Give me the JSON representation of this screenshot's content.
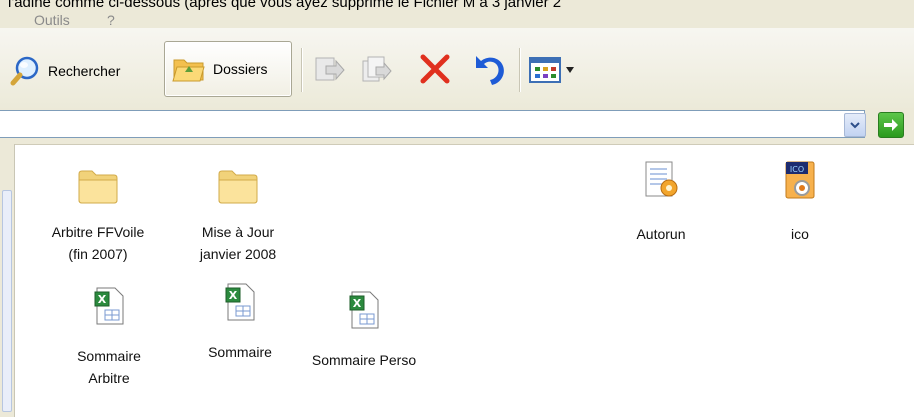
{
  "top_caption": "l'adine comme ci-dessous (après que vous ayez supprimé le Fichier M à 3 janvier 2",
  "menu": {
    "items": [
      "Outils",
      "?"
    ]
  },
  "toolbar": {
    "search_label": "Rechercher",
    "folders_label": "Dossiers",
    "icons": [
      "search-icon",
      "folders-icon",
      "move-to-icon",
      "copy-to-icon",
      "delete-icon",
      "undo-icon",
      "views-icon"
    ]
  },
  "address": {
    "value": ""
  },
  "files": [
    {
      "name_lines": [
        "Arbitre FFVoile",
        "(fin 2007)"
      ],
      "type": "folder"
    },
    {
      "name_lines": [
        "Mise à Jour",
        "janvier 2008"
      ],
      "type": "folder"
    },
    {
      "name_lines": [
        "Autorun"
      ],
      "type": "inf"
    },
    {
      "name_lines": [
        "ico"
      ],
      "type": "ico"
    },
    {
      "name_lines": [
        "Sommaire",
        "Arbitre"
      ],
      "type": "excel"
    },
    {
      "name_lines": [
        "Sommaire"
      ],
      "type": "excel"
    },
    {
      "name_lines": [
        "Sommaire Perso"
      ],
      "type": "excel"
    }
  ],
  "colors": {
    "delete": "#e0301e",
    "undo": "#1e5bd6",
    "go": "#33a326",
    "menu_gray": "#8a8a8a"
  }
}
